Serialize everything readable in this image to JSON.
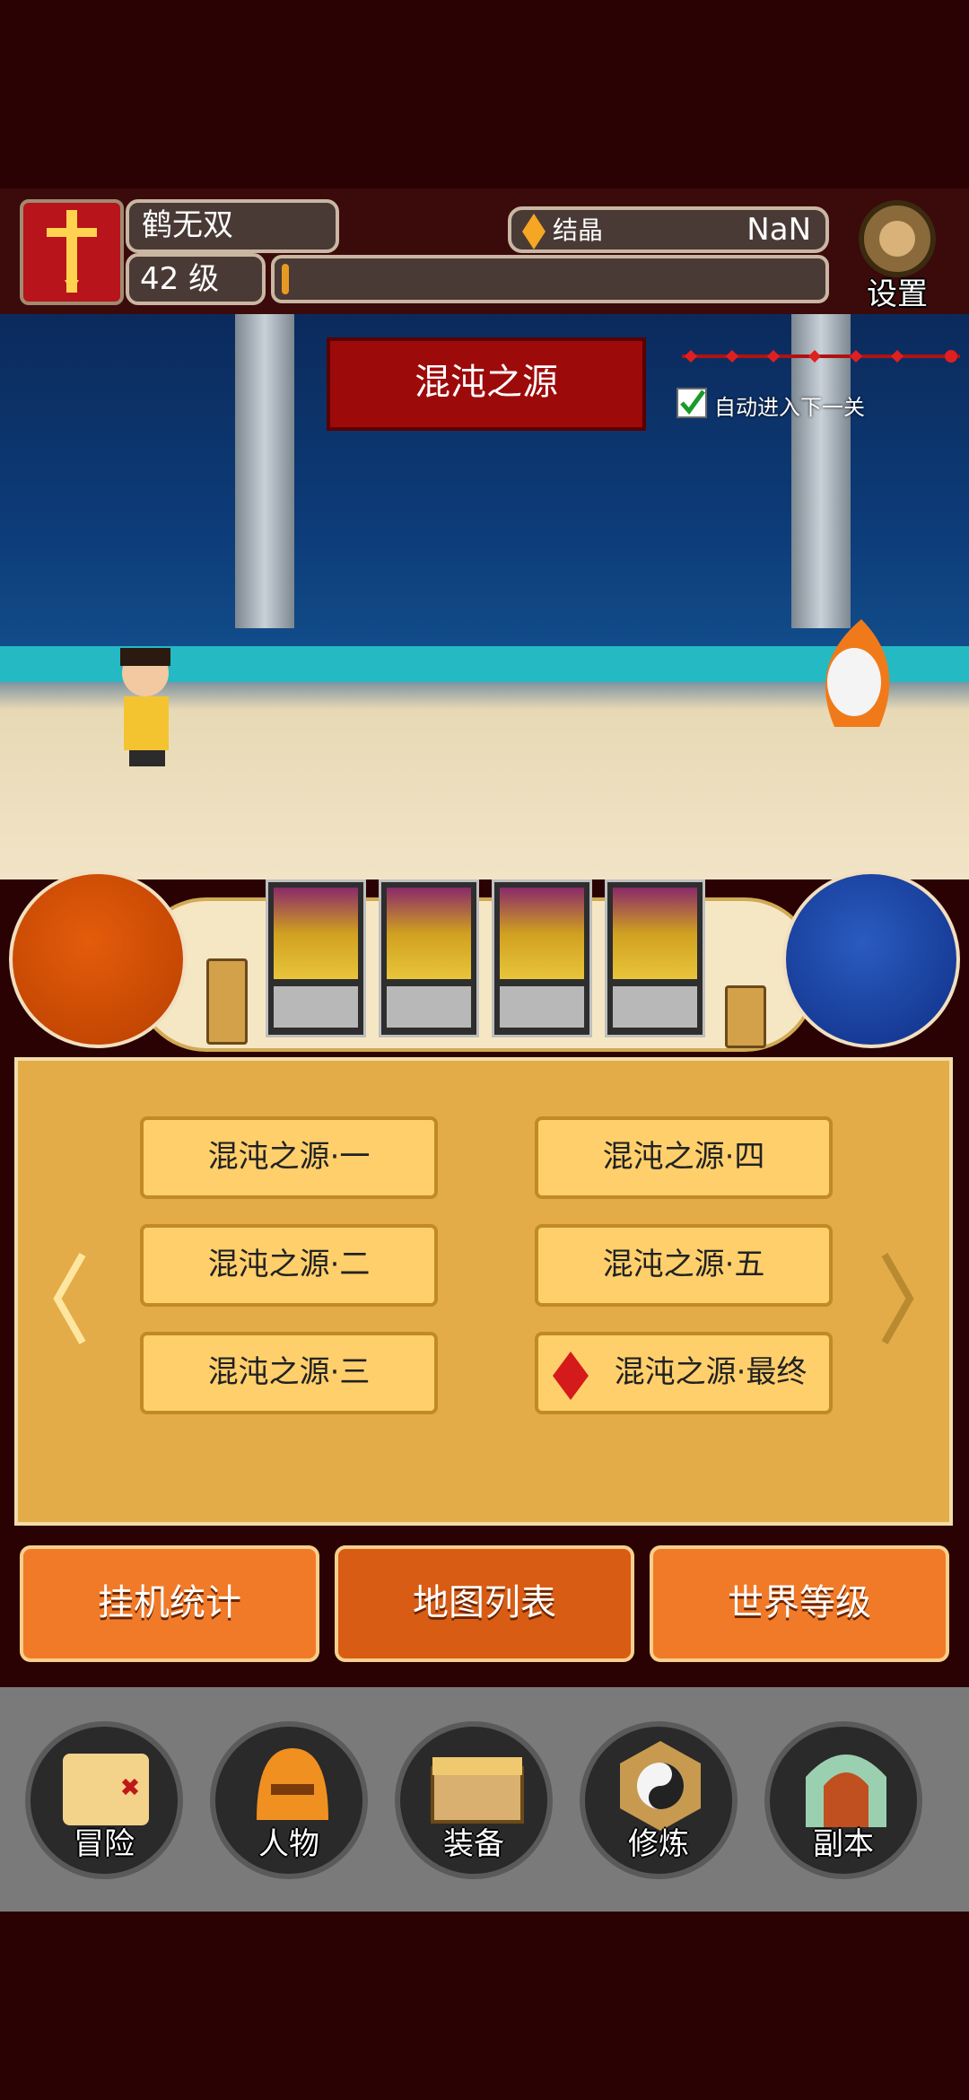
{
  "player": {
    "name": "鹤无双",
    "level": "42 级"
  },
  "currency": {
    "label": "结晶",
    "value": "NaN"
  },
  "settings_label": "设置",
  "stage": {
    "title": "混沌之源",
    "auto_next_label": "自动进入下一关",
    "auto_next_checked": true
  },
  "exp_progress": 0.01,
  "maps": [
    "混沌之源·一",
    "混沌之源·二",
    "混沌之源·三",
    "混沌之源·四",
    "混沌之源·五",
    "混沌之源·最终"
  ],
  "tabs": {
    "stats": "挂机统计",
    "map_list": "地图列表",
    "world_level": "世界等级"
  },
  "nav": {
    "adventure": "冒险",
    "character": "人物",
    "equipment": "装备",
    "cultivate": "修炼",
    "dungeon": "副本"
  },
  "colors": {
    "accent": "#f17a28",
    "banner": "#9d0a0a",
    "panel": "#e3ac48",
    "map_button": "#ffcf6b"
  },
  "icons": {
    "settings": "gear-icon",
    "crystal": "crystal-icon",
    "final_marker": "diamond-icon"
  }
}
